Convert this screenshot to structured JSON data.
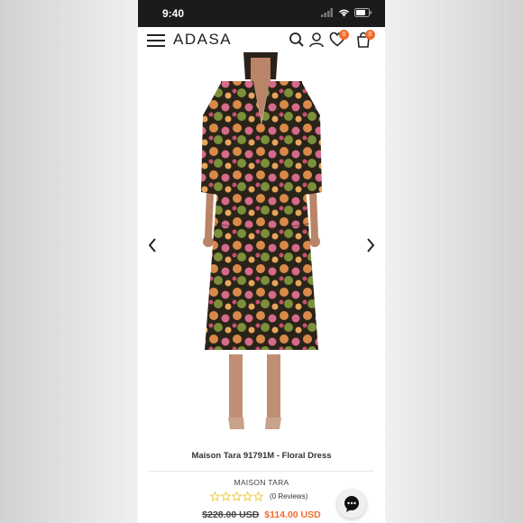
{
  "status_bar": {
    "time": "9:40"
  },
  "header": {
    "logo": "ADASA",
    "wishlist_count": "0",
    "cart_count": "0"
  },
  "product": {
    "title": "Maison Tara 91791M - Floral Dress",
    "brand": "MAISON TARA",
    "rating_stars": 0,
    "max_stars": 5,
    "reviews_label": "(0 Reviews)",
    "old_price": "$228.00 USD",
    "new_price": "$114.00 USD"
  },
  "colors": {
    "accent": "#f26b2b",
    "status_bar": "#1b1b1b",
    "star": "#e8c93a"
  }
}
